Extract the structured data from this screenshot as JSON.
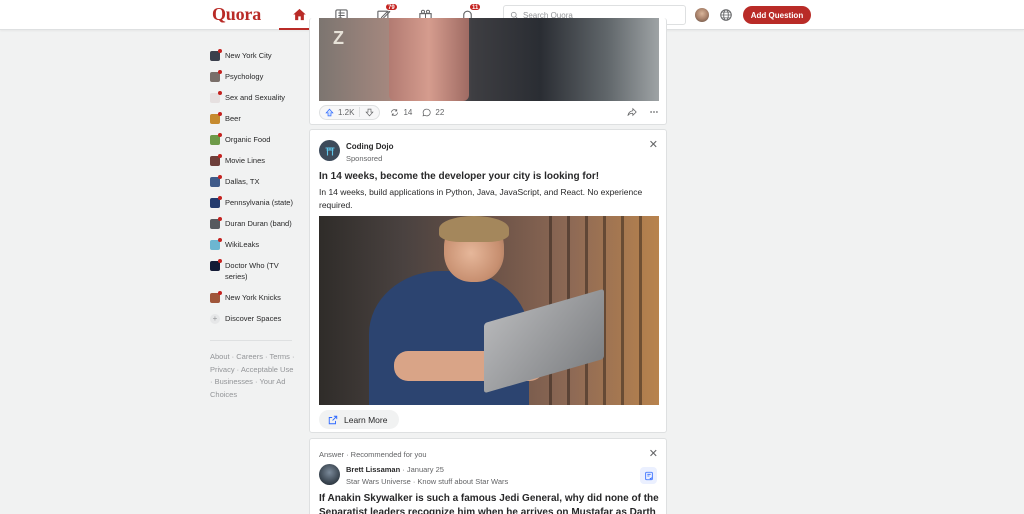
{
  "header": {
    "logo": "Quora",
    "brand_color": "#b92b27",
    "nav": [
      {
        "name": "home-icon",
        "active": true
      },
      {
        "name": "answer-feed-icon"
      },
      {
        "name": "answer-icon",
        "badge": "79"
      },
      {
        "name": "spaces-icon"
      },
      {
        "name": "notifications-icon",
        "badge": "11"
      }
    ],
    "search_placeholder": "Search Quora",
    "add_question_label": "Add Question"
  },
  "sidebar": {
    "items": [
      {
        "label": "New York City",
        "color": "#3b3f4c"
      },
      {
        "label": "Psychology",
        "color": "#7a6f6a"
      },
      {
        "label": "Sex and Sexuality",
        "color": "#e6e0e0"
      },
      {
        "label": "Beer",
        "color": "#c68a2e"
      },
      {
        "label": "Organic Food",
        "color": "#6d9a48"
      },
      {
        "label": "Movie Lines",
        "color": "#6e3f3a"
      },
      {
        "label": "Dallas, TX",
        "color": "#3f5b8a"
      },
      {
        "label": "Pennsylvania (state)",
        "color": "#233b6e"
      },
      {
        "label": "Duran Duran (band)",
        "color": "#575a5f"
      },
      {
        "label": "WikiLeaks",
        "color": "#6db6d1"
      },
      {
        "label": "Doctor Who (TV series)",
        "color": "#141b36"
      },
      {
        "label": "New York Knicks",
        "color": "#a0563a"
      }
    ],
    "discover_label": "Discover Spaces",
    "footer": "About · Careers · Terms · Privacy · Acceptable Use · Businesses · Your Ad Choices"
  },
  "feed": {
    "post1": {
      "upvotes": "1.2K",
      "shares": "14",
      "comments": "22"
    },
    "ad": {
      "advertiser": "Coding Dojo",
      "sponsored_label": "Sponsored",
      "headline": "In 14 weeks, become the developer your city is looking for!",
      "body": "In 14 weeks, build applications in Python, Java, JavaScript, and React. No experience required.",
      "cta_label": "Learn More"
    },
    "answer": {
      "rec_label": "Answer · Recommended for you",
      "author": "Brett Lissaman",
      "date": "· January 25",
      "credential": "Star Wars Universe · Know stuff about Star Wars",
      "question": "If Anakin Skywalker is such a famous Jedi General, why did none of the Separatist leaders recognize him when he arrives on Mustafar as Darth"
    }
  }
}
